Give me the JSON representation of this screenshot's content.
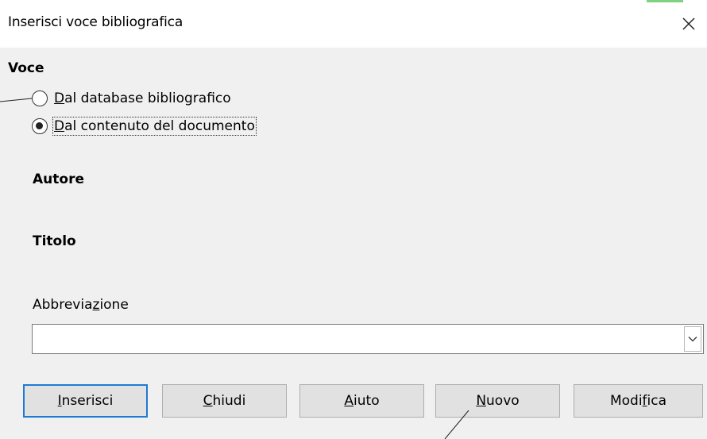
{
  "window": {
    "title": "Inserisci voce bibliografica",
    "close_icon": "close-icon"
  },
  "entry": {
    "section_label": "Voce",
    "options": [
      {
        "pre": "",
        "key": "D",
        "post": "al database bibliografico",
        "selected": false
      },
      {
        "pre": "",
        "key": "D",
        "post": "al contenuto del documento",
        "selected": true
      }
    ]
  },
  "fields": {
    "author_label": "Autore",
    "title_label": "Titolo",
    "short_name": {
      "label_pre": "Abbrevia",
      "label_key": "z",
      "label_post": "ione",
      "value": "",
      "dropdown_icon": "chevron-down-icon"
    }
  },
  "buttons": {
    "insert": {
      "pre": "",
      "key": "I",
      "post": "nserisci"
    },
    "close": {
      "pre": "",
      "key": "C",
      "post": "hiudi"
    },
    "help": {
      "pre": "",
      "key": "A",
      "post": "iuto"
    },
    "new": {
      "pre": "",
      "key": "N",
      "post": "uovo"
    },
    "edit": {
      "pre": "Modi",
      "key": "f",
      "post": "ica"
    }
  },
  "colors": {
    "dialog_background": "#f0f0f0",
    "titlebar_background": "#ffffff",
    "default_button_border": "#1e7ad4",
    "button_background": "#e1e1e1"
  }
}
